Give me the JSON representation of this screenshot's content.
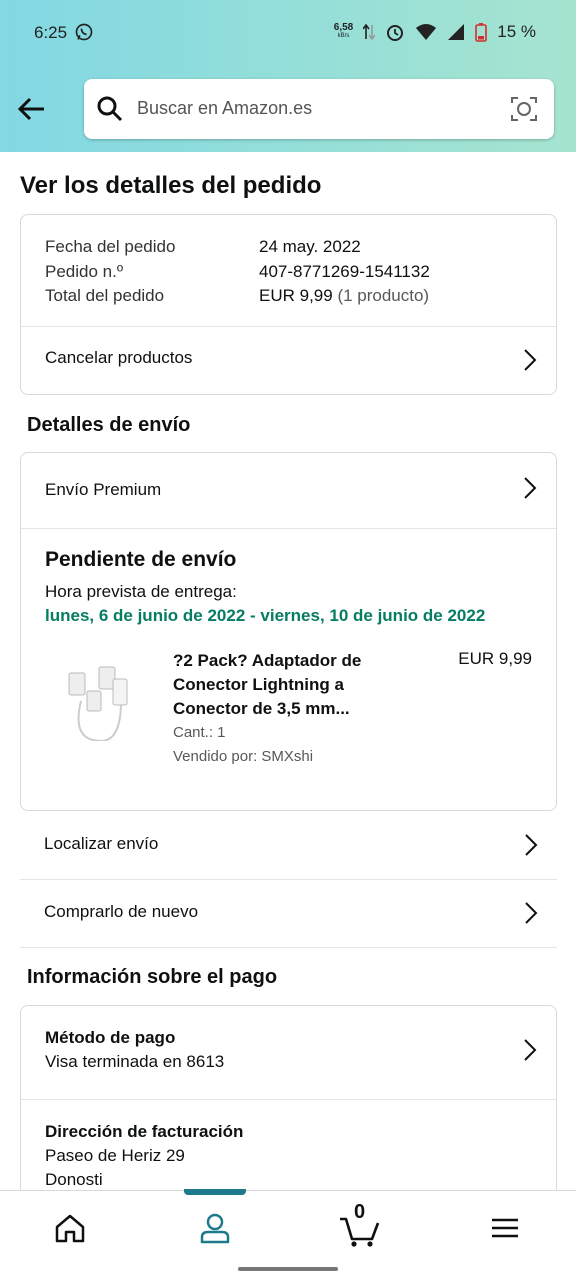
{
  "status_bar": {
    "time": "6:25",
    "net_speed": "6,58",
    "net_unit": "kB/s",
    "battery": "15 %"
  },
  "search": {
    "placeholder": "Buscar en Amazon.es"
  },
  "page_title": "Ver los detalles del pedido",
  "order": {
    "date_label": "Fecha del pedido",
    "date_value": "24 may. 2022",
    "number_label": "Pedido n.º",
    "number_value": "407-8771269-1541132",
    "total_label": "Total del pedido",
    "total_value": "EUR 9,99",
    "total_count": "(1 producto)",
    "cancel_label": "Cancelar productos"
  },
  "shipping": {
    "section_title": "Detalles de envío",
    "method": "Envío Premium",
    "status": "Pendiente de envío",
    "eta_label": "Hora prevista de entrega:",
    "eta_value": "lunes, 6 de junio de 2022 - viernes, 10 de junio de 2022",
    "product": {
      "title_line1": "?2 Pack? Adaptador de",
      "title_line2": "Conector Lightning a",
      "title_line3": "Conector de 3,5 mm...",
      "price": "EUR 9,99",
      "qty": "Cant.: 1",
      "seller": "Vendido por: SMXshi"
    },
    "track_label": "Localizar envío",
    "buy_again_label": "Comprarlo de nuevo"
  },
  "payment": {
    "section_title": "Información sobre el pago",
    "method_label": "Método de pago",
    "method_value": "Visa terminada en 8613",
    "billing_label": "Dirección de facturación",
    "billing_line1": "Paseo de Heriz 29",
    "billing_line2": "Donosti"
  },
  "bottom_nav": {
    "cart_count": "0"
  },
  "colors": {
    "accent": "#1e7a8a",
    "eta_green": "#067d62"
  }
}
